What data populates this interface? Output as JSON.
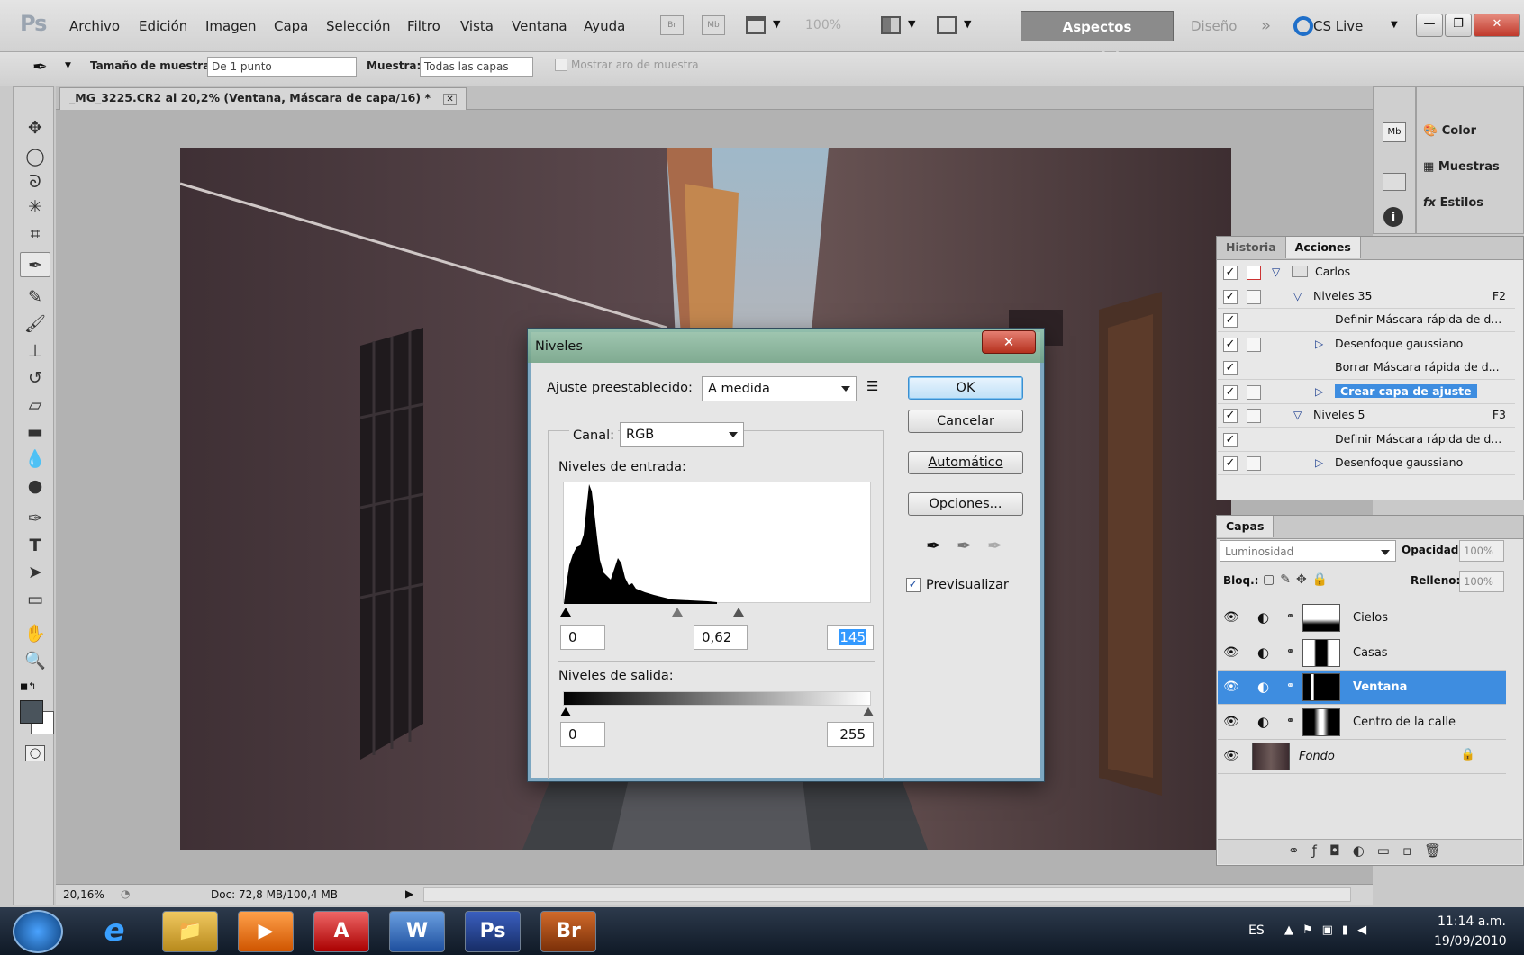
{
  "app": {
    "logo": "Ps"
  },
  "menu": [
    "Archivo",
    "Edición",
    "Imagen",
    "Capa",
    "Selección",
    "Filtro",
    "Vista",
    "Ventana",
    "Ayuda"
  ],
  "menubar_icons": {
    "br": "Br",
    "mb": "Mb",
    "zoom": "100%"
  },
  "workspace": {
    "active": "Aspectos esenciales",
    "other": "Diseño",
    "more": "»",
    "cslive": "CS Live"
  },
  "window_controls": {
    "minimize": "—",
    "restore": "❐",
    "close": "✕"
  },
  "options": {
    "sample_size_label": "Tamaño de muestra:",
    "sample_size_value": "De 1 punto",
    "sample_label": "Muestra:",
    "sample_value": "Todas las capas",
    "show_ring_label": "Mostrar aro de muestra"
  },
  "document": {
    "tab_title": "_MG_3225.CR2 al 20,2% (Ventana, Máscara de capa/16) *",
    "tab_close": "✕"
  },
  "status": {
    "zoom": "20,16%",
    "doc": "Doc: 72,8 MB/100,4 MB"
  },
  "right_icons": {
    "mb": "Mb"
  },
  "collapsed_panels": [
    {
      "icon": "🎨",
      "label": "Color"
    },
    {
      "icon": "▦",
      "label": "Muestras"
    },
    {
      "icon": "fx",
      "label": "Estilos"
    }
  ],
  "actions_panel": {
    "tabs": [
      "Historia",
      "Acciones"
    ],
    "rows": [
      {
        "label": "Carlos",
        "shortcut": "",
        "indent": 0,
        "toggle": "▽",
        "dialog": "red",
        "folder": true,
        "selected": false
      },
      {
        "label": "Niveles 35",
        "shortcut": "F2",
        "indent": 1,
        "toggle": "▽",
        "dialog": "yes",
        "folder": false,
        "selected": false
      },
      {
        "label": "Definir Máscara rápida de d...",
        "shortcut": "",
        "indent": 2,
        "toggle": "",
        "dialog": "",
        "folder": false,
        "selected": false
      },
      {
        "label": "Desenfoque gaussiano",
        "shortcut": "",
        "indent": 2,
        "toggle": "▷",
        "dialog": "yes",
        "folder": false,
        "selected": false
      },
      {
        "label": "Borrar Máscara rápida de d...",
        "shortcut": "",
        "indent": 2,
        "toggle": "",
        "dialog": "",
        "folder": false,
        "selected": false
      },
      {
        "label": "Crear capa de ajuste",
        "shortcut": "",
        "indent": 2,
        "toggle": "▷",
        "dialog": "yes",
        "folder": false,
        "selected": true
      },
      {
        "label": "Niveles 5",
        "shortcut": "F3",
        "indent": 1,
        "toggle": "▽",
        "dialog": "yes",
        "folder": false,
        "selected": false
      },
      {
        "label": "Definir Máscara rápida de d...",
        "shortcut": "",
        "indent": 2,
        "toggle": "",
        "dialog": "",
        "folder": false,
        "selected": false
      },
      {
        "label": "Desenfoque gaussiano",
        "shortcut": "",
        "indent": 2,
        "toggle": "▷",
        "dialog": "yes",
        "folder": false,
        "selected": false
      }
    ]
  },
  "layers_panel": {
    "tab": "Capas",
    "blend_mode": "Luminosidad",
    "opacity_label": "Opacidad:",
    "opacity": "100%",
    "lock_label": "Bloq.:",
    "fill_label": "Relleno:",
    "fill": "100%",
    "layers": [
      {
        "name": "Cielos",
        "selected": false,
        "mask": "cielos",
        "italic": false
      },
      {
        "name": "Casas",
        "selected": false,
        "mask": "casas",
        "italic": false
      },
      {
        "name": "Ventana",
        "selected": true,
        "mask": "ventana",
        "italic": false
      },
      {
        "name": "Centro de la calle",
        "selected": false,
        "mask": "centro",
        "italic": false
      },
      {
        "name": "Fondo",
        "selected": false,
        "mask": "photo",
        "italic": true
      }
    ]
  },
  "dialog": {
    "title": "Niveles",
    "close": "✕",
    "preset_label": "Ajuste preestablecido:",
    "preset_value": "A medida",
    "channel_label": "Canal:",
    "channel_value": "RGB",
    "input_levels_label": "Niveles de entrada:",
    "input_black": "0",
    "input_gamma": "0,62",
    "input_white": "145",
    "output_levels_label": "Niveles de salida:",
    "output_black": "0",
    "output_white": "255",
    "buttons": {
      "ok": "OK",
      "cancel": "Cancelar",
      "auto": "Automático",
      "options": "Opciones..."
    },
    "preview_label": "Previsualizar",
    "preview_checked": true
  },
  "taskbar": {
    "apps": [
      "e",
      "📁",
      "▶",
      "A",
      "W",
      "Ps",
      "Br"
    ],
    "lang": "ES",
    "time": "11:14 a.m.",
    "date": "19/09/2010"
  }
}
